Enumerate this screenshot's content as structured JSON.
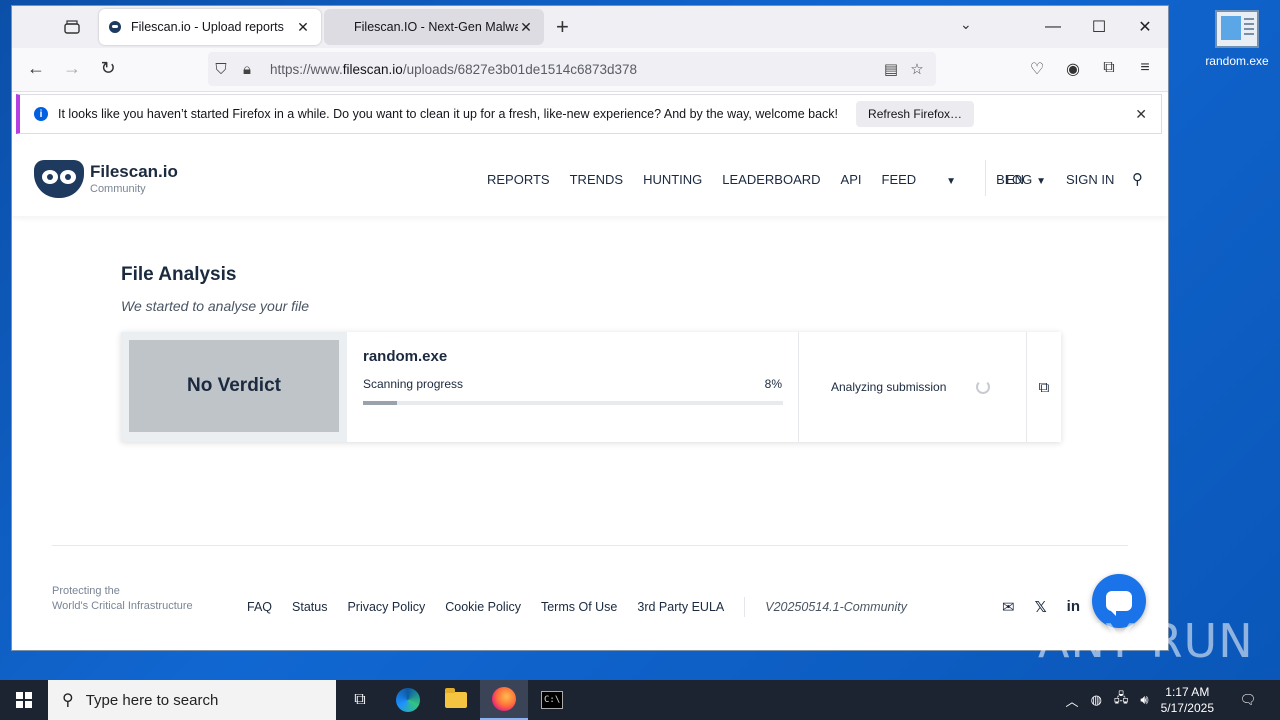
{
  "desktop": {
    "icon_label": "random.exe",
    "watermark": "ANY RUN"
  },
  "browser": {
    "tabs": [
      {
        "title": "Filescan.io - Upload reports",
        "active": true
      },
      {
        "title": "Filescan.IO - Next-Gen Malwar",
        "active": false
      }
    ],
    "url_prefix": "https://www.",
    "url_domain": "filescan.io",
    "url_path": "/uploads/6827e3b01de1514c6873d378",
    "notification": {
      "message": "It looks like you haven’t started Firefox in a while. Do you want to clean it up for a fresh, like-new experience? And by the way, welcome back!",
      "button": "Refresh Firefox…"
    }
  },
  "site": {
    "logo_name": "Filescan.io",
    "logo_sub": "Community",
    "nav": [
      "REPORTS",
      "TRENDS",
      "HUNTING",
      "LEADERBOARD",
      "API",
      "FEED",
      "BLOG"
    ],
    "lang": "EN",
    "signin": "SIGN IN"
  },
  "analysis": {
    "title": "File Analysis",
    "subtitle": "We started to analyse your file",
    "verdict": "No Verdict",
    "file_name": "random.exe",
    "progress_label": "Scanning progress",
    "progress_text": "8%",
    "progress_value": 0.08,
    "status": "Analyzing submission"
  },
  "footer": {
    "tagline_1": "Protecting the",
    "tagline_2": "World's Critical Infrastructure",
    "links": [
      "FAQ",
      "Status",
      "Privacy Policy",
      "Cookie Policy",
      "Terms Of Use",
      "3rd Party EULA"
    ],
    "version": "V20250514.1-Community"
  },
  "taskbar": {
    "search_placeholder": "Type here to search",
    "time": "1:17 AM",
    "date": "5/17/2025"
  },
  "colors": {
    "brand_dark": "#1b2a3f",
    "accent_blue": "#1a73e8",
    "verdict_gray": "#bfc4c9"
  }
}
